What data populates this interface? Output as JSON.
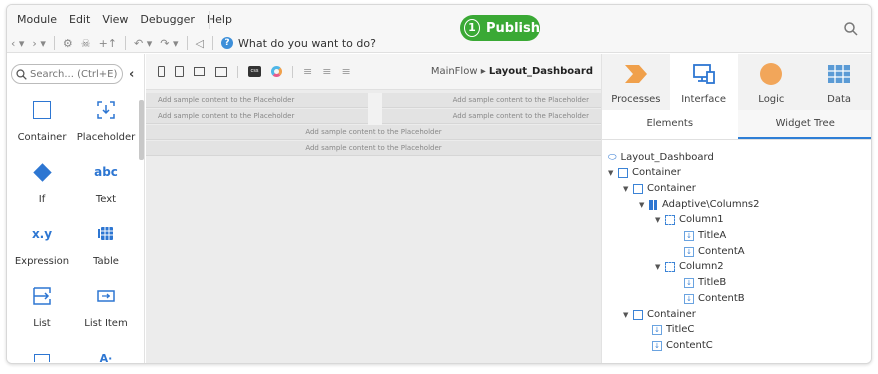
{
  "menu": {
    "items": [
      "Module",
      "Edit",
      "View",
      "Debugger",
      "Help"
    ]
  },
  "toolbar": {
    "help_text": "What do you want to do?"
  },
  "publish": {
    "step": "1",
    "label": "Publish"
  },
  "left_panel": {
    "search_placeholder": "Search... (Ctrl+E)",
    "widgets": [
      {
        "label": "Container",
        "icon": "container-icon"
      },
      {
        "label": "Placeholder",
        "icon": "placeholder-icon"
      },
      {
        "label": "If",
        "icon": "if-icon"
      },
      {
        "label": "Text",
        "icon": "text-icon",
        "glyph": "abc"
      },
      {
        "label": "Expression",
        "icon": "expression-icon",
        "glyph": "x.y"
      },
      {
        "label": "Table",
        "icon": "table-icon"
      },
      {
        "label": "List",
        "icon": "list-icon"
      },
      {
        "label": "List Item",
        "icon": "list-item-icon"
      }
    ]
  },
  "canvas": {
    "breadcrumb_parent": "MainFlow",
    "breadcrumb_current": "Layout_Dashboard",
    "placeholder_text": "Add sample content to the Placeholder"
  },
  "right_panel": {
    "tabs": [
      {
        "label": "Processes",
        "icon": "processes-icon"
      },
      {
        "label": "Interface",
        "icon": "interface-icon"
      },
      {
        "label": "Logic",
        "icon": "logic-icon"
      },
      {
        "label": "Data",
        "icon": "data-icon"
      }
    ],
    "active_tab": "Interface",
    "subtabs": [
      "Elements",
      "Widget Tree"
    ],
    "active_subtab": "Widget Tree",
    "tree": [
      {
        "label": "Layout_Dashboard",
        "depth": 0,
        "kind": "layout",
        "caret": false
      },
      {
        "label": "Container",
        "depth": 0,
        "kind": "container",
        "caret": true
      },
      {
        "label": "Container",
        "depth": 1,
        "kind": "container",
        "caret": true
      },
      {
        "label": "Adaptive\\Columns2",
        "depth": 2,
        "kind": "columns",
        "caret": true
      },
      {
        "label": "Column1",
        "depth": 3,
        "kind": "column",
        "caret": true
      },
      {
        "label": "TitleA",
        "depth": 4,
        "kind": "placeholder",
        "caret": false
      },
      {
        "label": "ContentA",
        "depth": 4,
        "kind": "placeholder",
        "caret": false
      },
      {
        "label": "Column2",
        "depth": 3,
        "kind": "column",
        "caret": true
      },
      {
        "label": "TitleB",
        "depth": 4,
        "kind": "placeholder",
        "caret": false
      },
      {
        "label": "ContentB",
        "depth": 4,
        "kind": "placeholder",
        "caret": false
      },
      {
        "label": "Container",
        "depth": 1,
        "kind": "container",
        "caret": true
      },
      {
        "label": "TitleC",
        "depth": 2,
        "kind": "placeholder",
        "caret": false
      },
      {
        "label": "ContentC",
        "depth": 2,
        "kind": "placeholder",
        "caret": false
      }
    ]
  },
  "colors": {
    "publish_green": "#3aa935",
    "accent_blue": "#2f7fd6",
    "processes_orange": "#f0a04b",
    "logic_orange": "#f2a65a",
    "data_blue": "#5b9bd5"
  }
}
